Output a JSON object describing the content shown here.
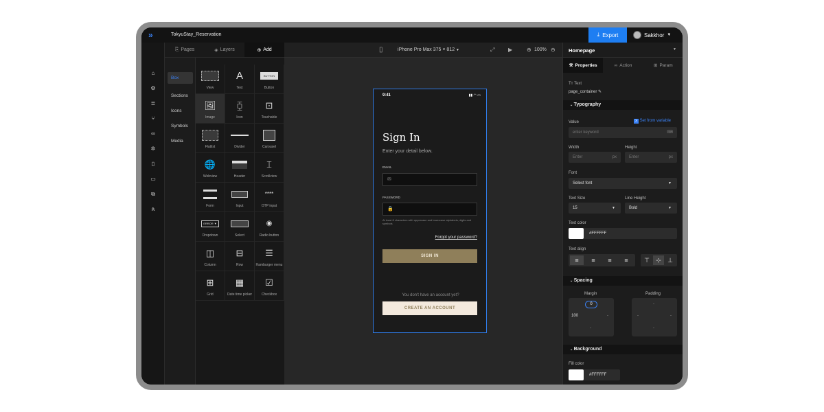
{
  "project_name": "TokyuStay_Reservation",
  "export_label": "Export",
  "user_name": "Sakkhor",
  "left_tabs": [
    "Pages",
    "Layers",
    "Add"
  ],
  "categories": [
    "Box",
    "Sections",
    "Icons",
    "Symbols",
    "Media"
  ],
  "components": [
    {
      "label": "View",
      "icon": "view-icon"
    },
    {
      "label": "Text",
      "icon": "text-icon"
    },
    {
      "label": "Button",
      "icon": "button-icon",
      "icon_text": "BUTTON"
    },
    {
      "label": "Image",
      "icon": "image-icon"
    },
    {
      "label": "Icon",
      "icon": "icon-icon"
    },
    {
      "label": "Touchable",
      "icon": "touchable-icon"
    },
    {
      "label": "Flatlist",
      "icon": "flatlist-icon"
    },
    {
      "label": "Divider",
      "icon": "divider-icon"
    },
    {
      "label": "Carousel",
      "icon": "carousel-icon"
    },
    {
      "label": "Webview",
      "icon": "webview-icon"
    },
    {
      "label": "Header",
      "icon": "header-icon"
    },
    {
      "label": "Scrollview",
      "icon": "scrollview-icon"
    },
    {
      "label": "Form",
      "icon": "form-icon"
    },
    {
      "label": "Input",
      "icon": "input-icon"
    },
    {
      "label": "OTP input",
      "icon": "otp-icon",
      "icon_text": "****"
    },
    {
      "label": "Dropdown",
      "icon": "dropdown-icon",
      "icon_text": "ERROR ▼"
    },
    {
      "label": "Select",
      "icon": "select-icon"
    },
    {
      "label": "Radio button",
      "icon": "radio-icon"
    },
    {
      "label": "Column",
      "icon": "column-icon"
    },
    {
      "label": "Row",
      "icon": "row-icon"
    },
    {
      "label": "Hamburger menu",
      "icon": "hamburger-icon"
    },
    {
      "label": "Grid",
      "icon": "grid-icon"
    },
    {
      "label": "Date time picker",
      "icon": "calendar-icon"
    },
    {
      "label": "Checkbox",
      "icon": "checkbox-icon"
    }
  ],
  "device_label": "iPhone Pro Max 375 × 812",
  "zoom": "100%",
  "phone": {
    "time": "9:41",
    "title": "Sign In",
    "subtitle": "Enter your detail below.",
    "email_label": "EMAIL",
    "password_label": "PASSWORD",
    "hint": "At least 8 characters with uppercase and lowercase alphabets, digits and symbols",
    "forgot": "Forgot your password?",
    "signin": "SIGN IN",
    "no_account": "You don't have an account yet?",
    "create": "CREATE AN ACCOUNT",
    "accent": "#8f7f5a",
    "create_bg": "#f3e9dd"
  },
  "right": {
    "page": "Homepage",
    "tabs": [
      "Properties",
      "Action",
      "Param"
    ],
    "element_type": "Text",
    "element_name": "page_container",
    "typography": "Typography",
    "value_label": "Value",
    "set_var": "Set from variable",
    "value_placeholder": "enter keyword",
    "width_label": "Width",
    "height_label": "Height",
    "width_ph": "Enter",
    "height_ph": "Enter",
    "unit": "px",
    "font_label": "Font",
    "font_value": "Select font",
    "size_label": "Text Size",
    "size_value": "15",
    "lh_label": "Line Height",
    "lh_value": "Bold",
    "color_label": "Text color",
    "color_value": "#FFFFFF",
    "align_label": "Text align",
    "spacing": "Spacing",
    "margin": "Margin",
    "padding": "Padding",
    "margin_top": "0",
    "margin_left": "100",
    "dash": "-",
    "background": "Background",
    "fill_label": "Fill color",
    "fill_value": "#FFFFFF"
  }
}
